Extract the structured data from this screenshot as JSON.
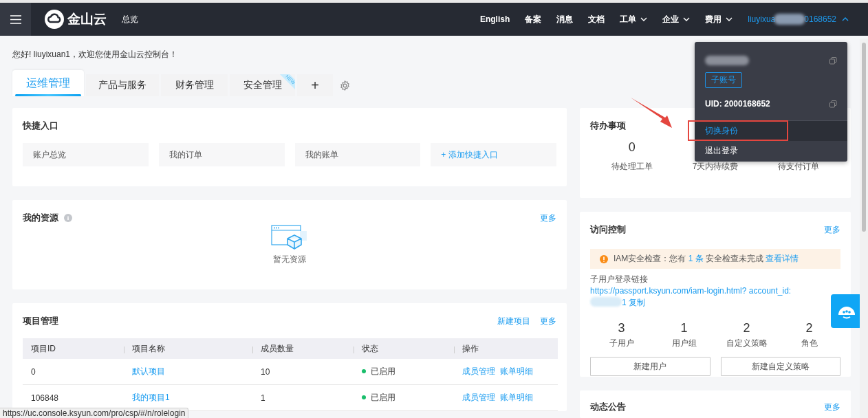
{
  "topbar": {
    "brand": "金山云",
    "title": "总览",
    "nav": [
      {
        "label": "English",
        "has_menu": false
      },
      {
        "label": "备案",
        "has_menu": false
      },
      {
        "label": "消息",
        "has_menu": false
      },
      {
        "label": "文档",
        "has_menu": false
      },
      {
        "label": "工单",
        "has_menu": true
      },
      {
        "label": "企业",
        "has_menu": true
      },
      {
        "label": "费用",
        "has_menu": true
      }
    ],
    "user": {
      "prefix": "liuyixua",
      "suffix": "0168652",
      "expanded": true
    }
  },
  "greeting": "您好! liuyixuan1，欢迎您使用金山云控制台！",
  "tabs": [
    {
      "label": "运维管理",
      "selected": true
    },
    {
      "label": "产品与服务",
      "selected": false
    },
    {
      "label": "财务管理",
      "selected": false
    },
    {
      "label": "安全管理",
      "selected": false,
      "badge": "NEW"
    }
  ],
  "add_tab": "+",
  "quick_entry": {
    "title": "快捷入口",
    "items": [
      {
        "label": "账户总览",
        "kind": "link"
      },
      {
        "label": "我的订单",
        "kind": "link"
      },
      {
        "label": "我的账单",
        "kind": "link"
      },
      {
        "label": "+ 添加快捷入口",
        "kind": "add"
      }
    ]
  },
  "resources": {
    "title": "我的资源",
    "more": "更多",
    "empty_text": "暂无资源"
  },
  "projects": {
    "title": "项目管理",
    "actions": [
      "新建项目",
      "更多"
    ],
    "columns": [
      "项目ID",
      "项目名称",
      "成员数量",
      "状态",
      "操作"
    ],
    "rows": [
      {
        "id": "0",
        "name": "默认项目",
        "members": "10",
        "status": "已启用",
        "ops": [
          "成员管理",
          "账单明细"
        ]
      },
      {
        "id": "106848",
        "name": "我的项目1",
        "members": "1",
        "status": "已启用",
        "ops": [
          "成员管理",
          "账单明细"
        ]
      }
    ]
  },
  "todo": {
    "title": "待办事项",
    "items": [
      {
        "value": "0",
        "label": "待处理工单"
      },
      {
        "label": "7天内待续费"
      },
      {
        "label": "待支付订单"
      }
    ]
  },
  "access": {
    "title": "访问控制",
    "more": "更多",
    "alert": [
      {
        "kind": "text",
        "text": "IAM安全检查：您有 "
      },
      {
        "kind": "link",
        "text": "1 条"
      },
      {
        "kind": "text",
        "text": " 安全检查未完成 "
      },
      {
        "kind": "link",
        "text": "查看详情"
      }
    ],
    "login_label": "子用户登录链接",
    "login_url": "https://passport.ksyun.com/iam-login.html?",
    "login_url_2": "account_id:",
    "login_url_end": "1",
    "copy": "复制",
    "stats": [
      {
        "value": "3",
        "label": "子用户"
      },
      {
        "value": "1",
        "label": "用户组"
      },
      {
        "value": "2",
        "label": "自定义策略"
      },
      {
        "value": "2",
        "label": "角色"
      }
    ],
    "buttons": [
      "新建用户",
      "新建自定义策略"
    ]
  },
  "announcements": {
    "title": "动态公告",
    "more": "更多"
  },
  "account_menu": {
    "role_tag": "子账号",
    "uid": "UID: 2000168652",
    "items": [
      {
        "label": "切换身份",
        "selected": true
      },
      {
        "label": "退出登录",
        "selected": false
      }
    ]
  },
  "status_bar": "https://uc.console.ksyun.com/pro/csp/#/n/rolelogin"
}
